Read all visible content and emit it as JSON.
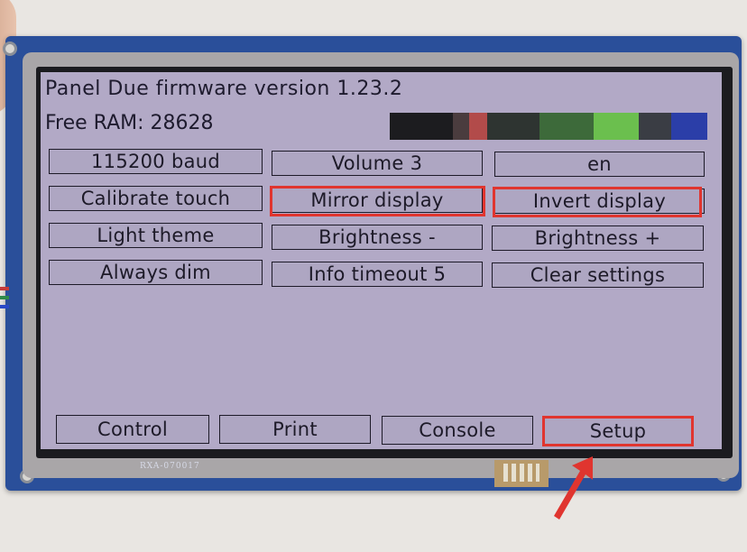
{
  "screen": {
    "title": "Panel Due firmware version 1.23.2",
    "free_ram": "Free RAM: 28628",
    "color_bar": [
      "#1c1c1f",
      "#4a3c3e",
      "#b24b4a",
      "#2e3431",
      "#3d6a3a",
      "#6bbf4e",
      "#3a3d44",
      "#2b3ea8"
    ]
  },
  "settings": {
    "baud": "115200 baud",
    "volume": "Volume 3",
    "language": "en",
    "calibrate": "Calibrate touch",
    "mirror": "Mirror display",
    "invert": "Invert display",
    "theme": "Light theme",
    "brightness_down": "Brightness -",
    "brightness_up": "Brightness +",
    "dim": "Always dim",
    "info_timeout": "Info timeout 5",
    "clear": "Clear settings"
  },
  "tabs": {
    "control": "Control",
    "print": "Print",
    "console": "Console",
    "setup": "Setup"
  },
  "board": {
    "silkscreen": "RXA-070017"
  },
  "colors": {
    "highlight": "#e0352f",
    "screen_bg": "#b2a9c6",
    "pcb": "#2a4f9a"
  }
}
